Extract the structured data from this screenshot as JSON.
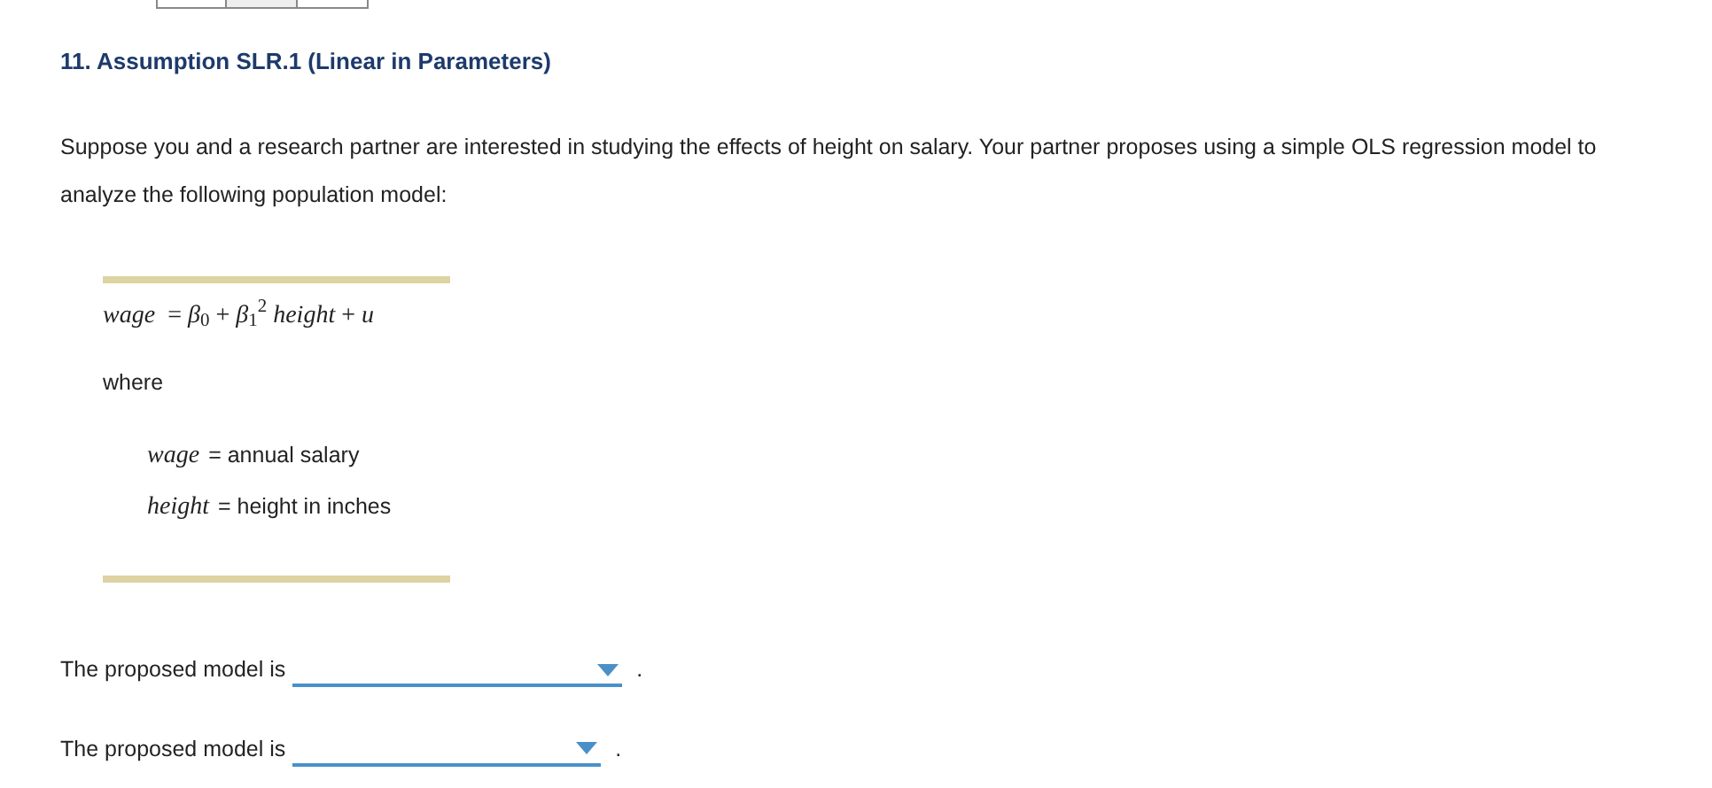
{
  "heading": "11. Assumption SLR.1 (Linear in Parameters)",
  "intro": "Suppose you and a research partner are interested in studying the effects of height on salary. Your partner proposes using a simple OLS regression model to analyze the following population model:",
  "model_box": {
    "equation": "*wage*  = *β*$_{0}$ + *β*$_{1}$$^{2}$ *height* + *u*",
    "where": "where",
    "definitions": [
      {
        "variable": "wage",
        "meaning": "= annual salary"
      },
      {
        "variable": "height",
        "meaning": "= height in inches"
      }
    ]
  },
  "questions": [
    {
      "prompt": "The proposed model is",
      "end": "."
    },
    {
      "prompt": "The proposed model is",
      "end": "."
    }
  ]
}
